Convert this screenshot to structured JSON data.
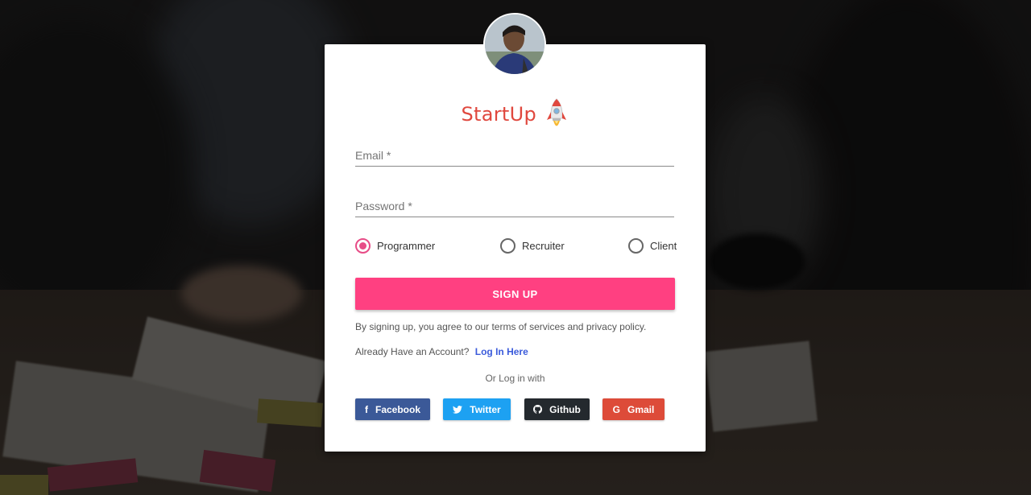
{
  "brand": {
    "name": "StartUp",
    "color": "#e0483e"
  },
  "avatar": {
    "alt": ""
  },
  "form": {
    "email": {
      "label": "Email *",
      "value": ""
    },
    "password": {
      "label": "Password *",
      "value": ""
    },
    "roles": [
      {
        "label": "Programmer",
        "checked": true
      },
      {
        "label": "Recruiter",
        "checked": false
      },
      {
        "label": "Client",
        "checked": false
      }
    ],
    "signup_label": "SIGN UP",
    "signup_color": "#ff4081",
    "terms_text": "By signing up, you agree to our terms of services and privacy policy.",
    "already_text": "Already Have an Account?",
    "login_link": "Log In Here",
    "or_text": "Or Log in with"
  },
  "social": [
    {
      "label": "Facebook",
      "icon": "facebook-icon",
      "color": "#3b5998"
    },
    {
      "label": "Twitter",
      "icon": "twitter-icon",
      "color": "#1da1f2"
    },
    {
      "label": "Github",
      "icon": "github-icon",
      "color": "#24292e"
    },
    {
      "label": "Gmail",
      "icon": "google-icon",
      "color": "#dd4b39"
    }
  ]
}
